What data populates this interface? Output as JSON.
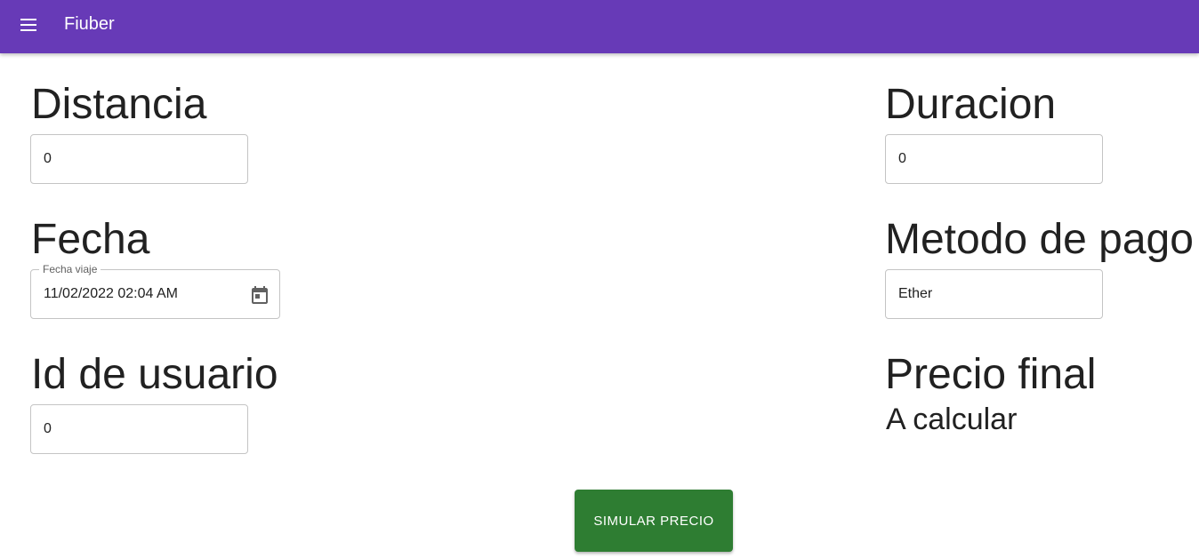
{
  "appbar": {
    "title": "Fiuber",
    "menu_icon": "menu-icon",
    "color": "#673ab7"
  },
  "form": {
    "distancia": {
      "label": "Distancia",
      "value": "0"
    },
    "duracion": {
      "label": "Duracion",
      "value": "0"
    },
    "fecha": {
      "label": "Fecha",
      "legend": "Fecha viaje",
      "value": "11/02/2022 02:04 AM",
      "icon": "calendar-icon"
    },
    "metodo_pago": {
      "label": "Metodo de pago",
      "value": "Ether"
    },
    "id_usuario": {
      "label": "Id de usuario",
      "value": "0"
    },
    "precio_final": {
      "label": "Precio final",
      "value": "A calcular"
    }
  },
  "actions": {
    "simular_label": "SIMULAR PRECIO",
    "button_color": "#2e7d32"
  }
}
